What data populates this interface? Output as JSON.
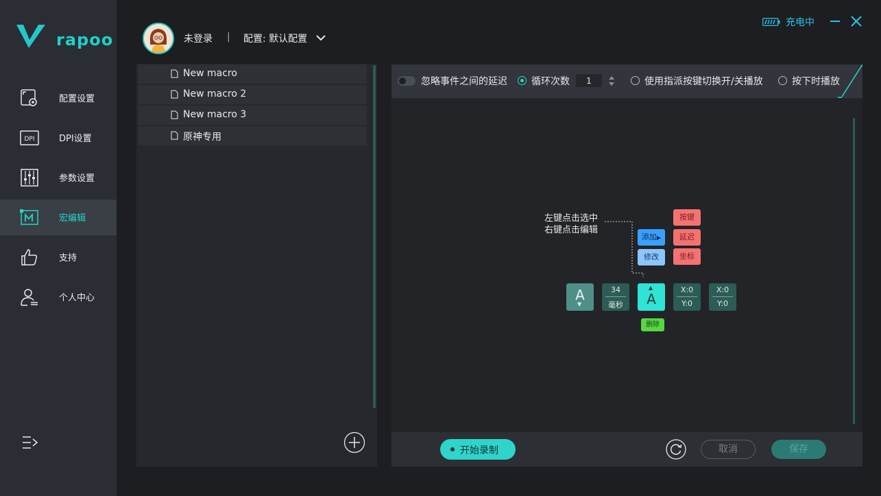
{
  "brand": {
    "name": "rapoo"
  },
  "header": {
    "user_name": "未登录",
    "separator": "|",
    "config_label": "配置: 默认配置",
    "charge_status": "充电中"
  },
  "sidebar": {
    "items": [
      {
        "label": "配置设置",
        "icon": "config-settings-icon",
        "active": false
      },
      {
        "label": "DPI设置",
        "icon": "dpi-icon",
        "active": false
      },
      {
        "label": "参数设置",
        "icon": "sliders-icon",
        "active": false
      },
      {
        "label": "宏编辑",
        "icon": "macro-icon",
        "active": true
      },
      {
        "label": "支持",
        "icon": "thumbs-up-icon",
        "active": false
      },
      {
        "label": "个人中心",
        "icon": "user-icon",
        "active": false
      }
    ]
  },
  "macros": [
    {
      "name": "New macro"
    },
    {
      "name": "New macro 2"
    },
    {
      "name": "New macro 3"
    },
    {
      "name": "原神专用"
    }
  ],
  "toolbar": {
    "ignore_delay_label": "忽略事件之间的延迟",
    "loop_label": "循环次数",
    "loop_count": "1",
    "toggle_key_label": "使用指派按键切换开/关播放",
    "hold_play_label": "按下时播放",
    "selected_mode": "loop"
  },
  "hint": {
    "left_click": "左键点击选中",
    "right_click": "右键点击编辑",
    "add": "添加",
    "modify": "修改",
    "key": "按键",
    "delay": "延迟",
    "coord": "坐标",
    "delete": "删除",
    "node_key": "A",
    "delay_value": "34",
    "delay_unit": "毫秒",
    "x_label": "X:0",
    "y_label": "Y:0"
  },
  "footer": {
    "start_record": "开始录制",
    "cancel": "取消",
    "save": "保存"
  },
  "colors": {
    "accent": "#2fd4ca",
    "sidebar": "#2a2d33",
    "danger": "#f47272"
  }
}
